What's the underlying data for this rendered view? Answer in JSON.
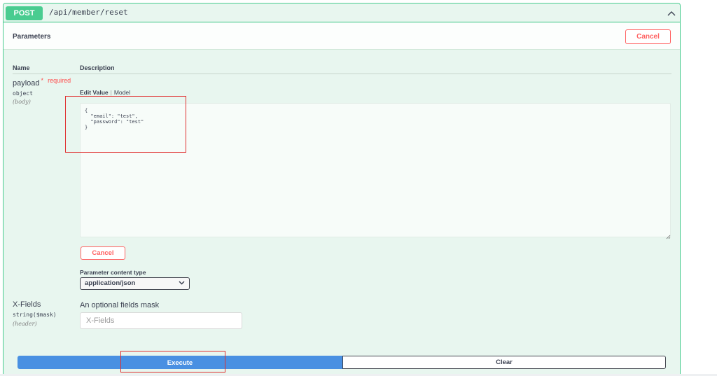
{
  "operation": {
    "method": "POST",
    "path": "/api/member/reset"
  },
  "parameters": {
    "title": "Parameters",
    "cancel_label": "Cancel",
    "columns": {
      "name": "Name",
      "description": "Description"
    },
    "payload": {
      "name": "payload",
      "required_mark": "*",
      "required_text": "required",
      "type": "object",
      "in": "(body)",
      "tab_edit_value": "Edit Value",
      "tab_separator": "|",
      "tab_model": "Model",
      "body_value": "{\n  \"email\": \"test\",\n  \"password\": \"test\"\n}",
      "cancel_label": "Cancel",
      "content_type_label": "Parameter content type",
      "content_type_value": "application/json"
    },
    "xfields": {
      "name": "X-Fields",
      "type": "string($mask)",
      "in": "(header)",
      "description": "An optional fields mask",
      "placeholder": "X-Fields",
      "value": ""
    }
  },
  "actions": {
    "execute_label": "Execute",
    "clear_label": "Clear"
  },
  "colors": {
    "method_post": "#49cc90",
    "execute": "#4990e2",
    "cancel": "#ff6060",
    "annotation": "#e03030"
  },
  "icons": {
    "collapse": "chevron-up-icon",
    "select": "chevron-down-icon",
    "resize": "resize-grip-icon"
  }
}
